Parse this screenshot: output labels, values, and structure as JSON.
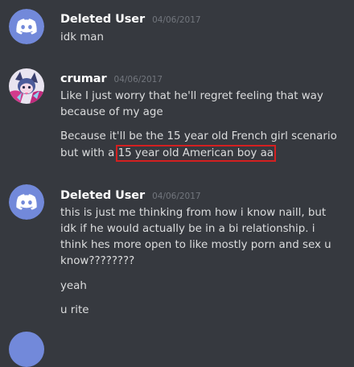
{
  "messages": [
    {
      "username": "Deleted User",
      "timestamp": "04/06/2017",
      "avatar": "discord-default-avatar",
      "lines": [
        "idk man"
      ]
    },
    {
      "username": "crumar",
      "timestamp": "04/06/2017",
      "avatar": "anime-character-avatar",
      "lines": [
        "Like I just worry that he'll regret feeling that way",
        "because of my age",
        "Because it'll be the 15 year old French girl scenario",
        "but with a ",
        "15 year old American boy aa"
      ]
    },
    {
      "username": "Deleted User",
      "timestamp": "04/06/2017",
      "avatar": "discord-default-avatar",
      "lines": [
        "this is just me thinking from how i know naill, but",
        "idk if he would actually be in a bi relationship. i",
        "think hes more open to like mostly porn and sex u",
        "know????????",
        "yeah",
        "u rite"
      ]
    }
  ],
  "colors": {
    "background": "#36393f",
    "username": "#ffffff",
    "timestamp": "#72767d",
    "text": "#dcddde",
    "discord_blurple": "#7289da",
    "highlight_box": "#d42020"
  }
}
